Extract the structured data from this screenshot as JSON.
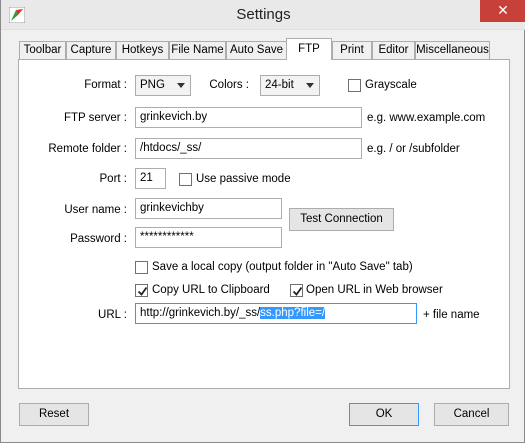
{
  "window": {
    "title": "Settings"
  },
  "tabs": [
    "Toolbar",
    "Capture",
    "Hotkeys",
    "File Name",
    "Auto Save",
    "FTP",
    "Print",
    "Editor",
    "Miscellaneous"
  ],
  "active_tab": "FTP",
  "format": {
    "label": "Format :",
    "value": "PNG",
    "colors_label": "Colors :",
    "colors_value": "24-bit",
    "grayscale_label": "Grayscale",
    "grayscale_checked": false
  },
  "ftp": {
    "server_label": "FTP server :",
    "server_value": "grinkevich.by",
    "server_hint": "e.g. www.example.com",
    "folder_label": "Remote folder :",
    "folder_value": "/htdocs/_ss/",
    "folder_hint": "e.g. / or /subfolder",
    "port_label": "Port :",
    "port_value": "21",
    "passive_label": "Use passive mode",
    "passive_checked": false,
    "user_label": "User name :",
    "user_value": "grinkevichby",
    "password_label": "Password :",
    "password_value": "************",
    "test_button": "Test Connection"
  },
  "options": {
    "save_local_label": "Save a local copy (output folder in \"Auto Save\" tab)",
    "save_local_checked": false,
    "copy_url_label": "Copy URL to Clipboard",
    "copy_url_checked": true,
    "open_url_label": "Open URL in Web browser",
    "open_url_checked": true
  },
  "url": {
    "label": "URL :",
    "value_plain": "http://grinkevich.by/_ss/",
    "value_selected": "ss.php?file=/",
    "suffix": "+ file name"
  },
  "buttons": {
    "reset": "Reset",
    "ok": "OK",
    "cancel": "Cancel"
  },
  "colors": {
    "close_button": "#c7403a",
    "selection": "#3399ff"
  }
}
